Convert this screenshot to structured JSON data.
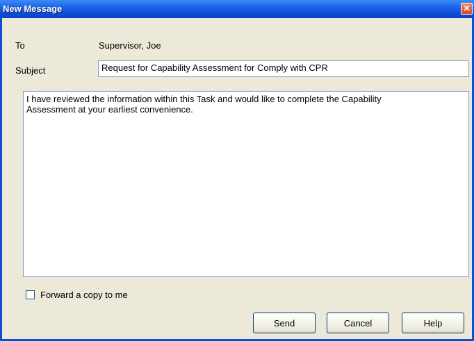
{
  "window": {
    "title": "New Message"
  },
  "fields": {
    "to_label": "To",
    "to_value": "Supervisor, Joe",
    "subject_label": "Subject",
    "subject_value": "Request for Capability Assessment for Comply with CPR",
    "body_text": "I have reviewed the information within this Task and would like to complete the Capability\nAssessment at your earliest convenience."
  },
  "options": {
    "forward_copy_label": "Forward a copy to me",
    "forward_copy_checked": false
  },
  "buttons": {
    "send": "Send",
    "cancel": "Cancel",
    "help": "Help"
  },
  "icons": {
    "close": "close-icon"
  },
  "colors": {
    "titlebar": "#0c4fd8",
    "dialog_bg": "#ece9d8",
    "close_button": "#d8441f"
  }
}
